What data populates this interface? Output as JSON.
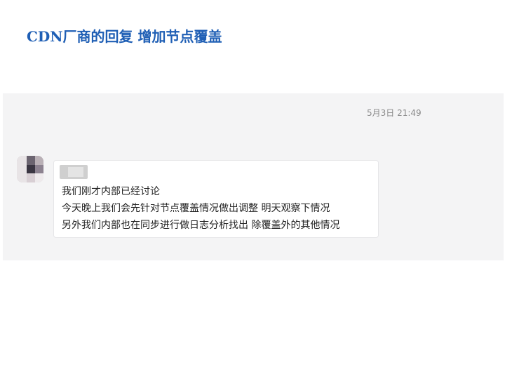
{
  "slide": {
    "title": "CDN厂商的回复 增加节点覆盖"
  },
  "chat": {
    "timestamp": "5月3日 21:49",
    "message": {
      "lines": [
        "我们刚才内部已经讨论",
        "今天晚上我们会先针对节点覆盖情况做出调整  明天观察下情况",
        "另外我们内部也在同步进行做日志分析找出 除覆盖外的其他情况"
      ]
    }
  }
}
